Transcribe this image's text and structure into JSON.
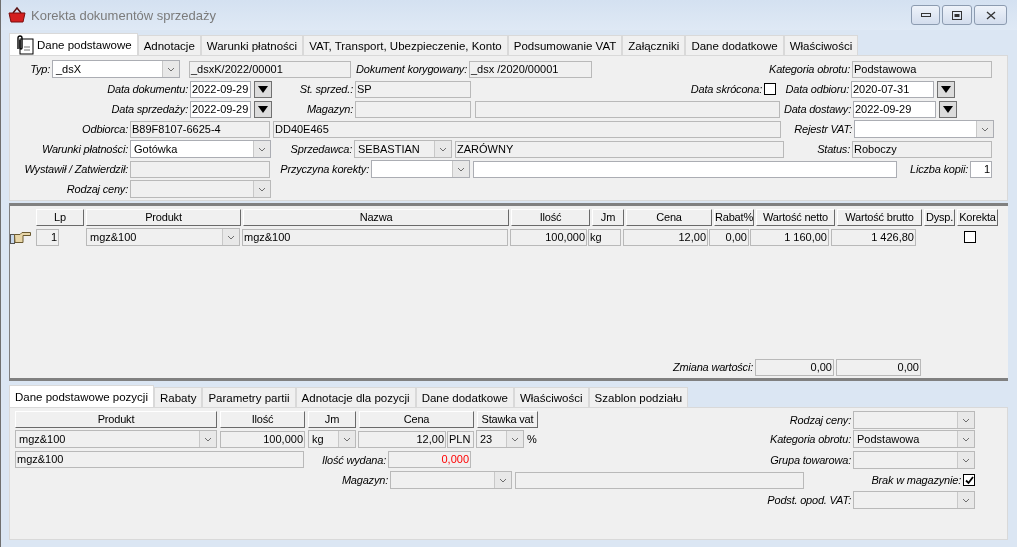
{
  "window": {
    "title": "Korekta dokumentów sprzedaży"
  },
  "tabs": [
    {
      "label": "Dane podstawowe",
      "selected": true
    },
    {
      "label": "Adnotacje",
      "selected": false
    },
    {
      "label": "Warunki płatności",
      "selected": false
    },
    {
      "label": "VAT, Transport, Ubezpieczenie, Konto",
      "selected": false
    },
    {
      "label": "Podsumowanie VAT",
      "selected": false
    },
    {
      "label": "Załączniki",
      "selected": false
    },
    {
      "label": "Dane dodatkowe",
      "selected": false
    },
    {
      "label": "Właściwości",
      "selected": false
    }
  ],
  "form": {
    "typ": {
      "label": "Typ:",
      "value": "_dsX",
      "number": "_dsxK/2022/00001",
      "editable": true
    },
    "dokument_korygowany": {
      "label": "Dokument korygowany:",
      "value": "_dsx /2020/00001",
      "editable": false
    },
    "kategoria_obrotu": {
      "label": "Kategoria obrotu:",
      "value": "Podstawowa",
      "editable": false
    },
    "data_dokumentu": {
      "label": "Data dokumentu:",
      "value": "2022-09-29",
      "editable": true
    },
    "st_sprzed": {
      "label": "St. sprzed.:",
      "value": "SP",
      "editable": false
    },
    "data_skrocona": {
      "label": "Data skrócona:",
      "checked": false
    },
    "data_odbioru": {
      "label": "Data odbioru:",
      "value": "2020-07-31",
      "editable": true
    },
    "data_sprzedazy": {
      "label": "Data sprzedaży:",
      "value": "2022-09-29",
      "editable": true
    },
    "magazyn": {
      "label": "Magazyn:",
      "editable": false
    },
    "data_dostawy": {
      "label": "Data dostawy:",
      "value": "2022-09-29",
      "editable": true
    },
    "odbiorca": {
      "label": "Odbiorca:",
      "code": "B89F8107-6625-4",
      "name": "DD40E465",
      "editable": false
    },
    "rejestr_vat": {
      "label": "Rejestr VAT:",
      "editable": true
    },
    "warunki_platnosci": {
      "label": "Warunki płatności:",
      "value": "Gotówka",
      "editable": true
    },
    "sprzedawca": {
      "label": "Sprzedawca:",
      "first_name": "SEBASTIAN",
      "last_name": "ZARÓWNY",
      "editable": false
    },
    "status": {
      "label": "Status:",
      "value": "Roboczy",
      "editable": false
    },
    "wystawil": {
      "label": "Wystawił / Zatwierdził:",
      "editable": false
    },
    "przyczyna_korekty": {
      "label": "Przyczyna korekty:",
      "editable": true
    },
    "liczba_kopii": {
      "label": "Liczba kopii:",
      "value": "1",
      "editable": true
    },
    "rodzaj_ceny": {
      "label": "Rodzaj ceny:",
      "editable": false
    }
  },
  "items": {
    "columns": [
      "Lp",
      "Produkt",
      "Nazwa",
      "Ilość",
      "Jm",
      "Cena",
      "Rabat%",
      "Wartość netto",
      "Wartość brutto",
      "Dysp.",
      "Korekta"
    ],
    "rows": [
      {
        "selected": true,
        "lp": "1",
        "produkt": "mgz&100",
        "nazwa": "mgz&100",
        "ilosc": "100,000",
        "jm": "kg",
        "cena": "12,00",
        "rabat": "0,00",
        "netto": "1 160,00",
        "brutto": "1 426,80",
        "korekta": false
      }
    ],
    "summary": {
      "label": "Zmiana wartości:",
      "netto": "0,00",
      "brutto": "0,00"
    }
  },
  "position_tabs": [
    {
      "label": "Dane podstawowe pozycji",
      "selected": true
    },
    {
      "label": "Rabaty",
      "selected": false
    },
    {
      "label": "Parametry partii",
      "selected": false
    },
    {
      "label": "Adnotacje dla pozycji",
      "selected": false
    },
    {
      "label": "Dane dodatkowe",
      "selected": false
    },
    {
      "label": "Właściwości",
      "selected": false
    },
    {
      "label": "Szablon podziału",
      "selected": false
    }
  ],
  "position": {
    "columns": [
      "Produkt",
      "Ilość",
      "Jm",
      "Cena",
      "Stawka vat"
    ],
    "produkt": "mgz&100",
    "ilosc": "100,000",
    "jm": "kg",
    "cena": "12,00",
    "waluta": "PLN",
    "stawka": "23",
    "stawka_unit": "%",
    "nazwa": "mgz&100",
    "ilosc_wydana": {
      "label": "Ilość wydana:",
      "value": "0,000"
    },
    "magazyn": {
      "label": "Magazyn:"
    },
    "rodzaj_ceny": {
      "label": "Rodzaj ceny:"
    },
    "kategoria_obrotu": {
      "label": "Kategoria obrotu:",
      "value": "Podstawowa"
    },
    "grupa_towarowa": {
      "label": "Grupa towarowa:"
    },
    "brak_w_magazynie": {
      "label": "Brak w magazynie:",
      "checked": true
    },
    "podst_opod_vat": {
      "label": "Podst. opod. VAT:"
    }
  }
}
